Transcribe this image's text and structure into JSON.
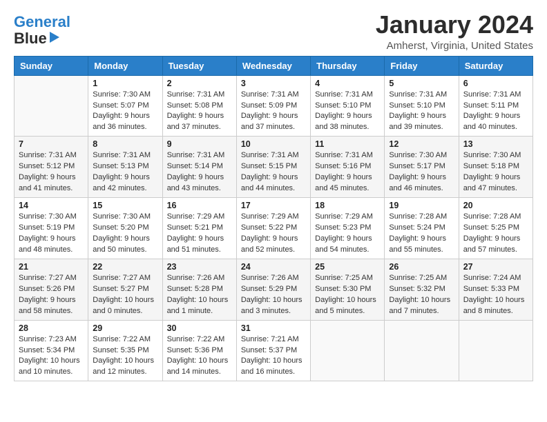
{
  "header": {
    "logo_line1": "General",
    "logo_line2": "Blue",
    "title": "January 2024",
    "subtitle": "Amherst, Virginia, United States"
  },
  "calendar": {
    "days_of_week": [
      "Sunday",
      "Monday",
      "Tuesday",
      "Wednesday",
      "Thursday",
      "Friday",
      "Saturday"
    ],
    "weeks": [
      [
        {
          "day": "",
          "info": ""
        },
        {
          "day": "1",
          "info": "Sunrise: 7:30 AM\nSunset: 5:07 PM\nDaylight: 9 hours\nand 36 minutes."
        },
        {
          "day": "2",
          "info": "Sunrise: 7:31 AM\nSunset: 5:08 PM\nDaylight: 9 hours\nand 37 minutes."
        },
        {
          "day": "3",
          "info": "Sunrise: 7:31 AM\nSunset: 5:09 PM\nDaylight: 9 hours\nand 37 minutes."
        },
        {
          "day": "4",
          "info": "Sunrise: 7:31 AM\nSunset: 5:10 PM\nDaylight: 9 hours\nand 38 minutes."
        },
        {
          "day": "5",
          "info": "Sunrise: 7:31 AM\nSunset: 5:10 PM\nDaylight: 9 hours\nand 39 minutes."
        },
        {
          "day": "6",
          "info": "Sunrise: 7:31 AM\nSunset: 5:11 PM\nDaylight: 9 hours\nand 40 minutes."
        }
      ],
      [
        {
          "day": "7",
          "info": "Sunrise: 7:31 AM\nSunset: 5:12 PM\nDaylight: 9 hours\nand 41 minutes."
        },
        {
          "day": "8",
          "info": "Sunrise: 7:31 AM\nSunset: 5:13 PM\nDaylight: 9 hours\nand 42 minutes."
        },
        {
          "day": "9",
          "info": "Sunrise: 7:31 AM\nSunset: 5:14 PM\nDaylight: 9 hours\nand 43 minutes."
        },
        {
          "day": "10",
          "info": "Sunrise: 7:31 AM\nSunset: 5:15 PM\nDaylight: 9 hours\nand 44 minutes."
        },
        {
          "day": "11",
          "info": "Sunrise: 7:31 AM\nSunset: 5:16 PM\nDaylight: 9 hours\nand 45 minutes."
        },
        {
          "day": "12",
          "info": "Sunrise: 7:30 AM\nSunset: 5:17 PM\nDaylight: 9 hours\nand 46 minutes."
        },
        {
          "day": "13",
          "info": "Sunrise: 7:30 AM\nSunset: 5:18 PM\nDaylight: 9 hours\nand 47 minutes."
        }
      ],
      [
        {
          "day": "14",
          "info": "Sunrise: 7:30 AM\nSunset: 5:19 PM\nDaylight: 9 hours\nand 48 minutes."
        },
        {
          "day": "15",
          "info": "Sunrise: 7:30 AM\nSunset: 5:20 PM\nDaylight: 9 hours\nand 50 minutes."
        },
        {
          "day": "16",
          "info": "Sunrise: 7:29 AM\nSunset: 5:21 PM\nDaylight: 9 hours\nand 51 minutes."
        },
        {
          "day": "17",
          "info": "Sunrise: 7:29 AM\nSunset: 5:22 PM\nDaylight: 9 hours\nand 52 minutes."
        },
        {
          "day": "18",
          "info": "Sunrise: 7:29 AM\nSunset: 5:23 PM\nDaylight: 9 hours\nand 54 minutes."
        },
        {
          "day": "19",
          "info": "Sunrise: 7:28 AM\nSunset: 5:24 PM\nDaylight: 9 hours\nand 55 minutes."
        },
        {
          "day": "20",
          "info": "Sunrise: 7:28 AM\nSunset: 5:25 PM\nDaylight: 9 hours\nand 57 minutes."
        }
      ],
      [
        {
          "day": "21",
          "info": "Sunrise: 7:27 AM\nSunset: 5:26 PM\nDaylight: 9 hours\nand 58 minutes."
        },
        {
          "day": "22",
          "info": "Sunrise: 7:27 AM\nSunset: 5:27 PM\nDaylight: 10 hours\nand 0 minutes."
        },
        {
          "day": "23",
          "info": "Sunrise: 7:26 AM\nSunset: 5:28 PM\nDaylight: 10 hours\nand 1 minute."
        },
        {
          "day": "24",
          "info": "Sunrise: 7:26 AM\nSunset: 5:29 PM\nDaylight: 10 hours\nand 3 minutes."
        },
        {
          "day": "25",
          "info": "Sunrise: 7:25 AM\nSunset: 5:30 PM\nDaylight: 10 hours\nand 5 minutes."
        },
        {
          "day": "26",
          "info": "Sunrise: 7:25 AM\nSunset: 5:32 PM\nDaylight: 10 hours\nand 7 minutes."
        },
        {
          "day": "27",
          "info": "Sunrise: 7:24 AM\nSunset: 5:33 PM\nDaylight: 10 hours\nand 8 minutes."
        }
      ],
      [
        {
          "day": "28",
          "info": "Sunrise: 7:23 AM\nSunset: 5:34 PM\nDaylight: 10 hours\nand 10 minutes."
        },
        {
          "day": "29",
          "info": "Sunrise: 7:22 AM\nSunset: 5:35 PM\nDaylight: 10 hours\nand 12 minutes."
        },
        {
          "day": "30",
          "info": "Sunrise: 7:22 AM\nSunset: 5:36 PM\nDaylight: 10 hours\nand 14 minutes."
        },
        {
          "day": "31",
          "info": "Sunrise: 7:21 AM\nSunset: 5:37 PM\nDaylight: 10 hours\nand 16 minutes."
        },
        {
          "day": "",
          "info": ""
        },
        {
          "day": "",
          "info": ""
        },
        {
          "day": "",
          "info": ""
        }
      ]
    ]
  }
}
